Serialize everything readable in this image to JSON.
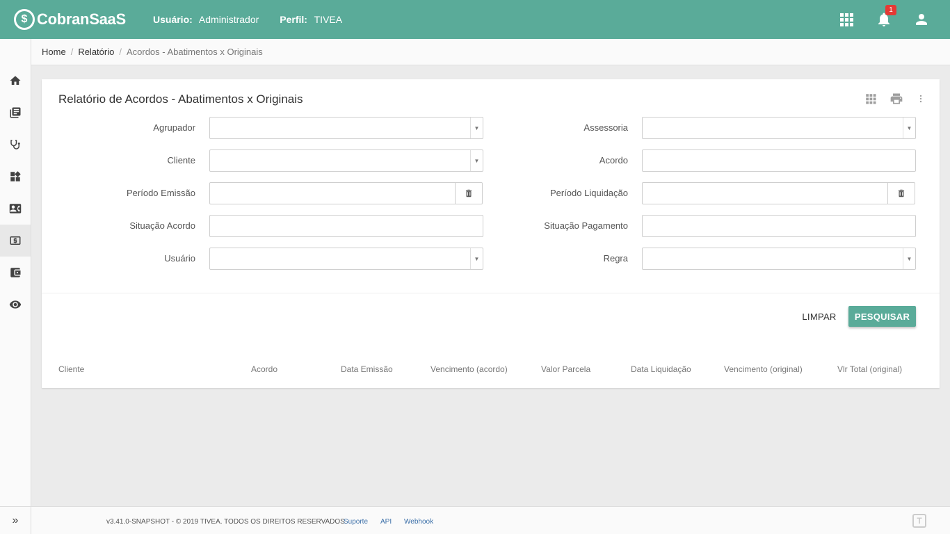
{
  "app": {
    "brand": "CobranSaaS",
    "logo_glyph": "$"
  },
  "header": {
    "user_label": "Usuário:",
    "user_value": "Administrador",
    "profile_label": "Perfil:",
    "profile_value": "TIVEA",
    "notification_count": "1"
  },
  "breadcrumb": {
    "home": "Home",
    "section": "Relatório",
    "current": "Acordos - Abatimentos x Originais"
  },
  "page": {
    "title": "Relatório de Acordos - Abatimentos x Originais"
  },
  "filters": {
    "agrupador": "Agrupador",
    "cliente": "Cliente",
    "periodo_emissao": "Período Emissão",
    "situacao_acordo": "Situação Acordo",
    "usuario": "Usuário",
    "assessoria": "Assessoria",
    "acordo": "Acordo",
    "periodo_liquidacao": "Período Liquidação",
    "situacao_pagamento": "Situação Pagamento",
    "regra": "Regra"
  },
  "actions": {
    "clear": "LIMPAR",
    "search": "PESQUISAR"
  },
  "table": {
    "columns": [
      "Cliente",
      "Acordo",
      "Data Emissão",
      "Vencimento (acordo)",
      "Valor Parcela",
      "Data Liquidação",
      "Vencimento (original)",
      "Vlr Total (original)"
    ]
  },
  "footer": {
    "version": "v3.41.0-SNAPSHOT - © 2019 TIVEA. TODOS OS DIREITOS RESERVADOS.",
    "links": [
      "Suporte",
      "API",
      "Webhook"
    ],
    "logo_glyph": "T"
  },
  "sidebar": {
    "items": [
      "home-icon",
      "library-books-icon",
      "stethoscope-icon",
      "widgets-icon",
      "contact-card-icon",
      "money-icon",
      "wallet-icon",
      "eye-icon"
    ],
    "active_index": 5
  },
  "colors": {
    "primary": "#5aab99",
    "badge": "#e53935"
  }
}
